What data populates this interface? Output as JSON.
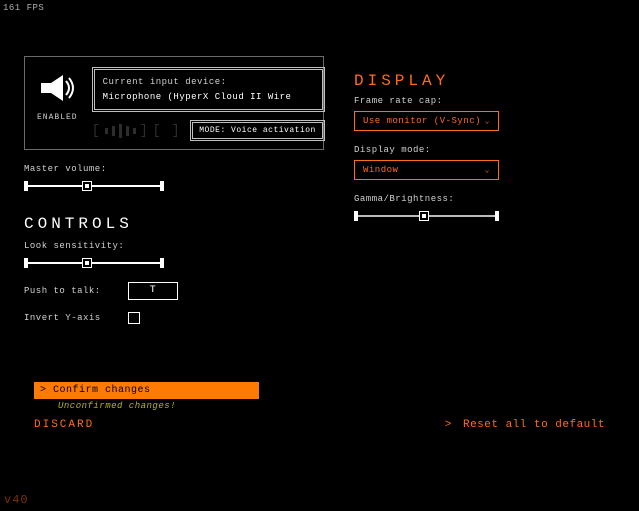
{
  "fps": "161 FPS",
  "audio": {
    "enabled_label": "ENABLED",
    "device_label": "Current input device:",
    "device_name": "Microphone (HyperX Cloud II Wire",
    "mode_label": "MODE: Voice activation"
  },
  "master_volume": {
    "label": "Master volume:",
    "value_pct": 45
  },
  "controls": {
    "heading": "CONTROLS",
    "look_sens": {
      "label": "Look sensitivity:",
      "value_pct": 45
    },
    "ptt": {
      "label": "Push to talk:",
      "key": "T"
    },
    "invert_y": {
      "label": "Invert Y-axis",
      "checked": false
    }
  },
  "display": {
    "heading": "DISPLAY",
    "frame_cap": {
      "label": "Frame rate cap:",
      "value": "Use monitor (V-Sync)"
    },
    "mode": {
      "label": "Display mode:",
      "value": "Window"
    },
    "gamma": {
      "label": "Gamma/Brightness:",
      "value_pct": 48
    }
  },
  "footer": {
    "confirm": "Confirm changes",
    "unconfirmed": "Unconfirmed changes!",
    "discard": "DISCARD",
    "reset": "Reset all to default"
  },
  "build": "v40"
}
